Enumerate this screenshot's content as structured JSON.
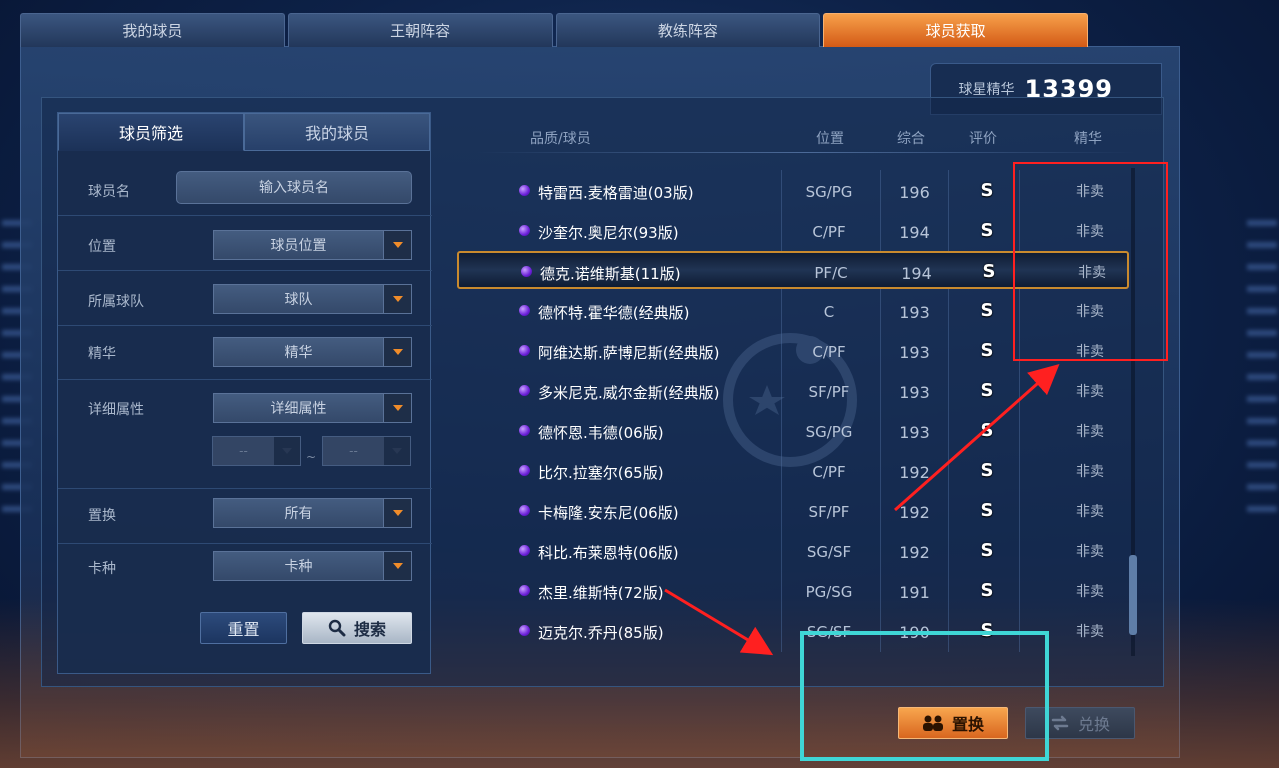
{
  "top_tabs": [
    "我的球员",
    "王朝阵容",
    "教练阵容",
    "球员获取"
  ],
  "active_top_tab": 3,
  "essence": {
    "label": "球星精华",
    "value": "13399"
  },
  "filter": {
    "tabs": [
      "球员筛选",
      "我的球员"
    ],
    "active_tab": 0,
    "name_label": "球员名",
    "name_placeholder": "输入球员名",
    "position_label": "位置",
    "position_value": "球员位置",
    "team_label": "所属球队",
    "team_value": "球队",
    "essence_label": "精华",
    "essence_value": "精华",
    "attr_label": "详细属性",
    "attr_value": "详细属性",
    "range_from": "--",
    "range_to": "--",
    "range_sep": "~",
    "swap_label": "置换",
    "swap_value": "所有",
    "card_label": "卡种",
    "card_value": "卡种",
    "reset_label": "重置",
    "search_label": "搜索"
  },
  "list": {
    "headers": {
      "player": "品质/球员",
      "position": "位置",
      "overall": "综合",
      "rating": "评价",
      "essence": "精华"
    },
    "rows": [
      {
        "name": "特雷西.麦格雷迪(03版)",
        "position": "SG/PG",
        "overall": "196",
        "rating": "S",
        "essence": "非卖"
      },
      {
        "name": "沙奎尔.奥尼尔(93版)",
        "position": "C/PF",
        "overall": "194",
        "rating": "S",
        "essence": "非卖"
      },
      {
        "name": "德克.诺维斯基(11版)",
        "position": "PF/C",
        "overall": "194",
        "rating": "S",
        "essence": "非卖"
      },
      {
        "name": "德怀特.霍华德(经典版)",
        "position": "C",
        "overall": "193",
        "rating": "S",
        "essence": "非卖"
      },
      {
        "name": "阿维达斯.萨博尼斯(经典版)",
        "position": "C/PF",
        "overall": "193",
        "rating": "S",
        "essence": "非卖"
      },
      {
        "name": "多米尼克.威尔金斯(经典版)",
        "position": "SF/PF",
        "overall": "193",
        "rating": "S",
        "essence": "非卖"
      },
      {
        "name": "德怀恩.韦德(06版)",
        "position": "SG/PG",
        "overall": "193",
        "rating": "S",
        "essence": "非卖"
      },
      {
        "name": "比尔.拉塞尔(65版)",
        "position": "C/PF",
        "overall": "192",
        "rating": "S",
        "essence": "非卖"
      },
      {
        "name": "卡梅隆.安东尼(06版)",
        "position": "SF/PF",
        "overall": "192",
        "rating": "S",
        "essence": "非卖"
      },
      {
        "name": "科比.布莱恩特(06版)",
        "position": "SG/SF",
        "overall": "192",
        "rating": "S",
        "essence": "非卖"
      },
      {
        "name": "杰里.维斯特(72版)",
        "position": "PG/SG",
        "overall": "191",
        "rating": "S",
        "essence": "非卖"
      },
      {
        "name": "迈克尔.乔丹(85版)",
        "position": "SG/SF",
        "overall": "190",
        "rating": "S",
        "essence": "非卖"
      }
    ],
    "selected_index": 2
  },
  "actions": {
    "replace_label": "置换",
    "exchange_label": "兑换"
  },
  "colors": {
    "accent": "#f08c2a",
    "quality_dot": "#7b2ff0",
    "annotation_red": "#ff2020",
    "annotation_cyan": "#3fd6d6"
  }
}
